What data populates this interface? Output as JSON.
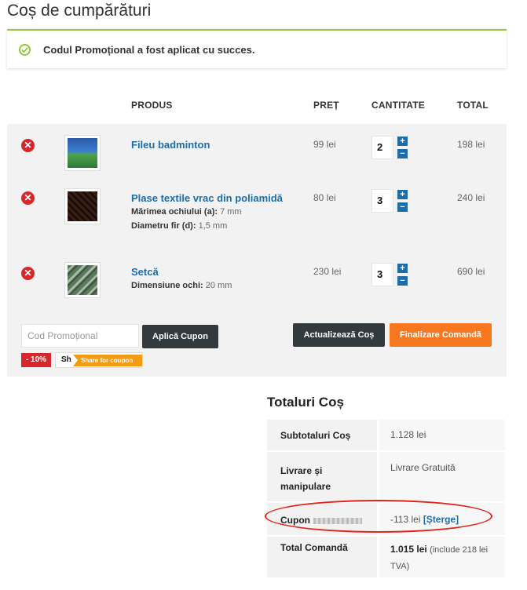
{
  "page": {
    "title": "Coș de cumpărături"
  },
  "notice": {
    "message": "Codul Promoțional a fost aplicat cu succes.",
    "icon": "check-circle-icon",
    "color": "#8fc73e"
  },
  "table": {
    "headers": {
      "product": "PRODUS",
      "price": "PREȚ",
      "quantity": "CANTITATE",
      "total": "TOTAL"
    }
  },
  "items": [
    {
      "name": "Fileu badminton",
      "price": "99 lei",
      "qty": "2",
      "total": "198 lei",
      "attrs": []
    },
    {
      "name": "Plase textile vrac din poliamidă",
      "price": "80 lei",
      "qty": "3",
      "total": "240 lei",
      "attrs": [
        {
          "label": "Mărimea ochiului (a):",
          "value": "7 mm"
        },
        {
          "label": "Diametru fir (d):",
          "value": "1,5 mm"
        }
      ]
    },
    {
      "name": "Setcă",
      "price": "230 lei",
      "qty": "3",
      "total": "690 lei",
      "attrs": [
        {
          "label": "Dimensiune ochi:",
          "value": "20 mm"
        }
      ]
    }
  ],
  "actions": {
    "coupon_placeholder": "Cod Promoțional",
    "apply_coupon": "Aplică Cupon",
    "update_cart": "Actualizează Coș",
    "checkout": "Finalizare Comandă",
    "discount_badge": "- 10%",
    "share_letters": "Sh",
    "share_label": "Share for coupon"
  },
  "totals": {
    "title": "Totaluri Coș",
    "subtotal_label": "Subtotaluri Coș",
    "subtotal_value": "1.128 lei",
    "shipping_label_1": "Livrare și",
    "shipping_label_2": "manipulare",
    "shipping_value": "Livrare Gratuită",
    "coupon_label": "Cupon",
    "coupon_value": "-113 lei",
    "coupon_remove": "[Șterge]",
    "order_total_label": "Total Comandă",
    "order_total_value": "1.015 lei",
    "order_total_note_1": "(include 218 lei",
    "order_total_note_2": "TVA)"
  },
  "colors": {
    "link": "#1e6da8",
    "remove": "#d9262b",
    "checkout": "#f7781e",
    "dark_button": "#323a3e",
    "highlight": "#e2231a"
  }
}
